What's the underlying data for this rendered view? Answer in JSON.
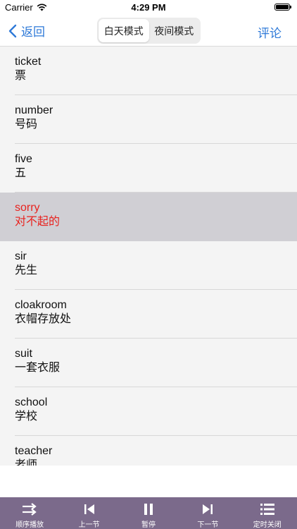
{
  "status_bar": {
    "carrier": "Carrier",
    "time": "4:29 PM"
  },
  "nav": {
    "back_label": "返回",
    "segments": [
      {
        "label": "白天模式",
        "selected": true
      },
      {
        "label": "夜间模式",
        "selected": false
      }
    ],
    "comment_label": "评论"
  },
  "words": [
    {
      "en": "ticket",
      "zh": "票"
    },
    {
      "en": "number",
      "zh": "号码"
    },
    {
      "en": "five",
      "zh": "五"
    },
    {
      "en": "sorry",
      "zh": "对不起的",
      "active": true
    },
    {
      "en": "sir",
      "zh": "先生"
    },
    {
      "en": "cloakroom",
      "zh": "衣帽存放处"
    },
    {
      "en": "suit",
      "zh": "一套衣服"
    },
    {
      "en": "school",
      "zh": "学校"
    },
    {
      "en": "teacher",
      "zh": "老师"
    }
  ],
  "player": {
    "buttons": [
      {
        "label": "顺序播放",
        "icon": "shuffle-icon"
      },
      {
        "label": "上一节",
        "icon": "previous-icon"
      },
      {
        "label": "暂停",
        "icon": "pause-icon"
      },
      {
        "label": "下一节",
        "icon": "next-icon"
      },
      {
        "label": "定时关闭",
        "icon": "timer-list-icon"
      }
    ]
  },
  "colors": {
    "accent": "#2f7ad8",
    "highlight_text": "#e8231f",
    "highlight_row": "#d0cfd4",
    "player_bg": "#7b6a8b"
  }
}
